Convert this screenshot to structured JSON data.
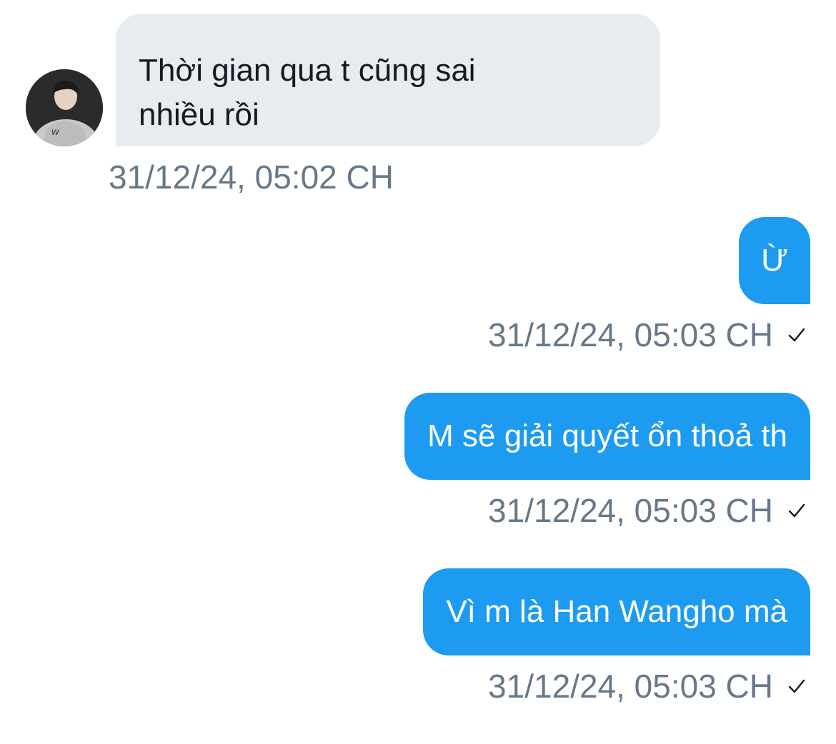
{
  "conversation": {
    "received": [
      {
        "text": "Thời gian qua t cũng sai\nnhiều rồi",
        "timestamp": "31/12/24, 05:02 CH",
        "avatar_icon": "user-avatar"
      }
    ],
    "sent": [
      {
        "text": "Ừ",
        "timestamp": "31/12/24, 05:03 CH",
        "status_icon": "check-icon"
      },
      {
        "text": "M sẽ giải quyết ổn thoả th",
        "timestamp": "31/12/24, 05:03 CH",
        "status_icon": "check-icon"
      },
      {
        "text": "Vì m là Han Wangho mà",
        "timestamp": "31/12/24, 05:03 CH",
        "status_icon": "check-icon"
      }
    ]
  },
  "colors": {
    "sent_bubble": "#1d9bf0",
    "received_bubble": "#e7ecf0",
    "timestamp_text": "#66788a",
    "received_text": "#141a20"
  }
}
